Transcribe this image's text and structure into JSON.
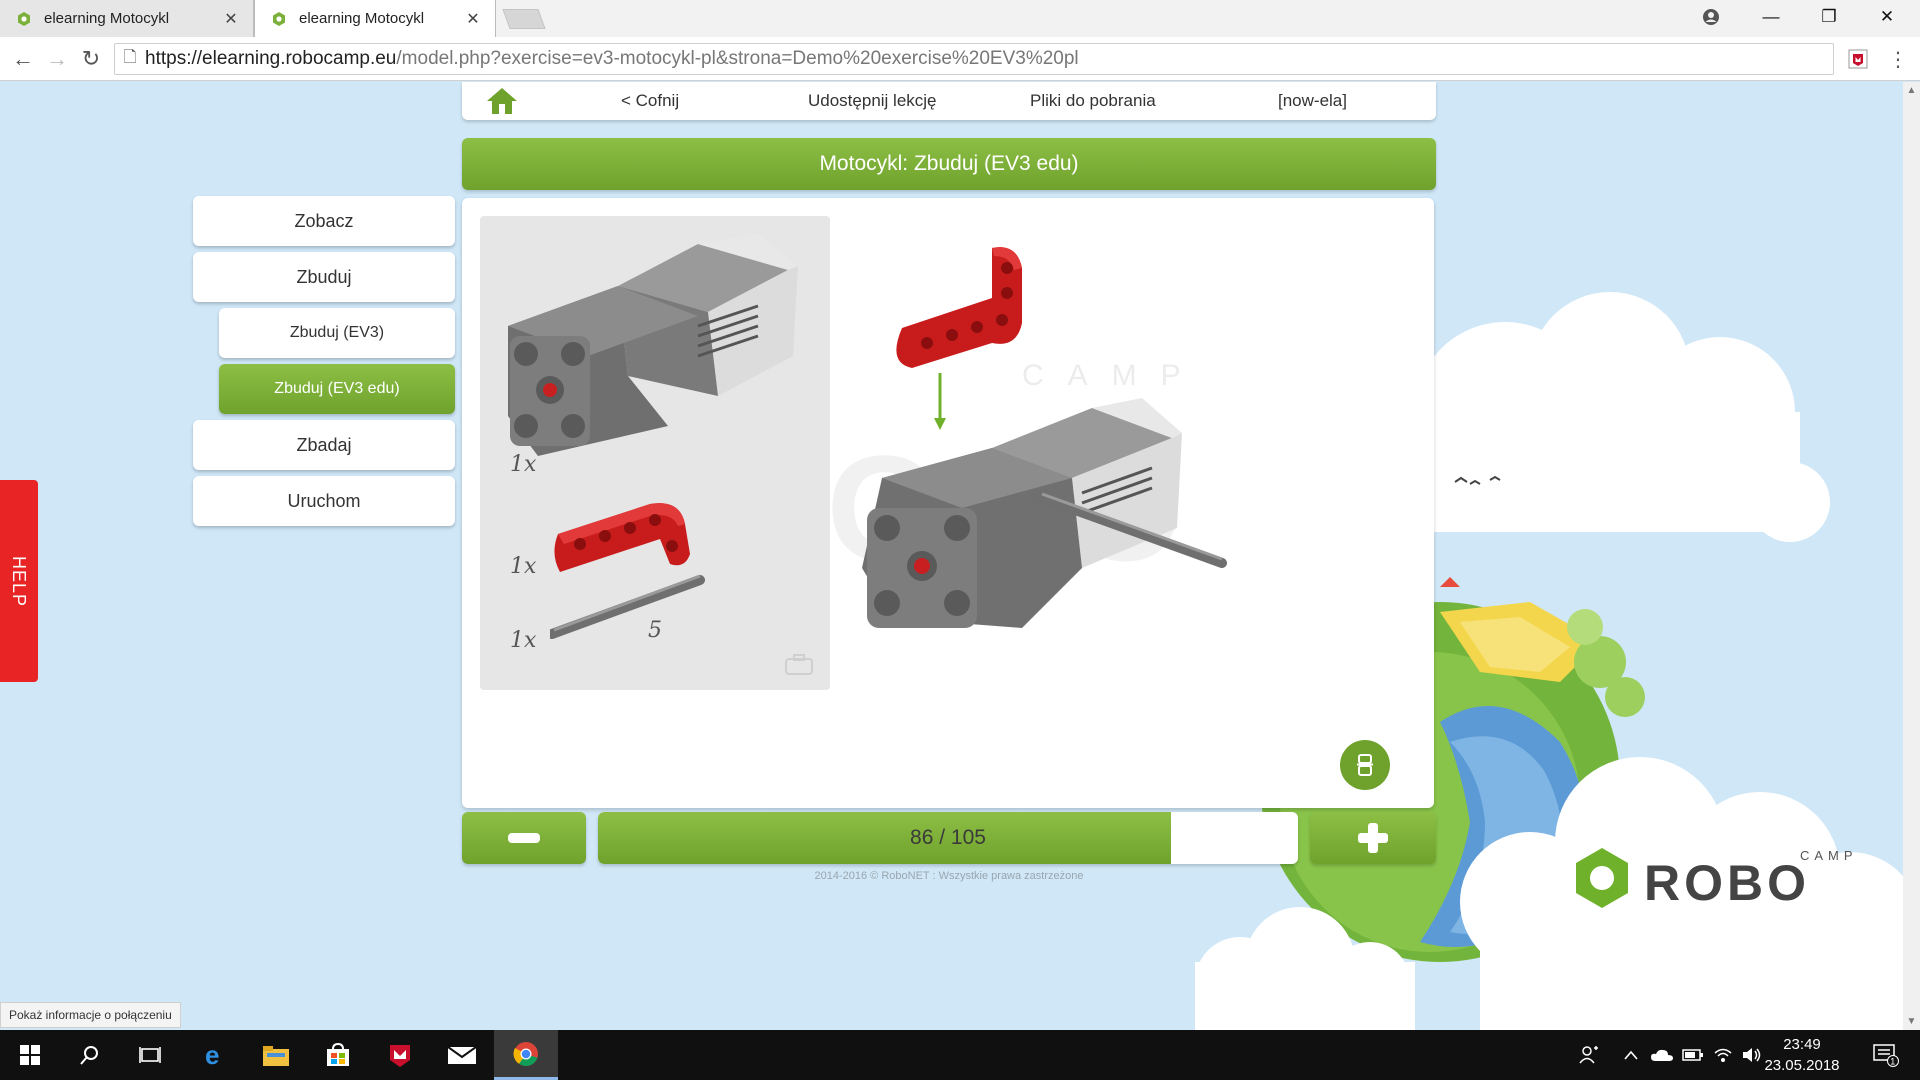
{
  "browser": {
    "tabs": [
      {
        "title": "elearning Motocykl",
        "close": "✕"
      },
      {
        "title": "elearning Motocykl",
        "close": "✕"
      }
    ],
    "window_controls": {
      "minimize": "—",
      "maximize": "❐",
      "close": "✕"
    },
    "nav": {
      "back": "←",
      "forward": "→",
      "reload": "↻"
    },
    "url_host": "https://elearning.robocamp.eu",
    "url_rest": "/model.php?exercise=ev3-motocykl-pl&strona=Demo%20exercise%20EV3%20pl",
    "status_bubble": "Pokaż informacje o połączeniu"
  },
  "topnav": {
    "back_label": "< Cofnij",
    "share_label": "Udostępnij lekcję",
    "downloads_label": "Pliki do pobrania",
    "user_label": "[now-ela]"
  },
  "header": {
    "title": "Motocykl: Zbuduj (EV3 edu)"
  },
  "sidebar": {
    "items": [
      {
        "label": "Zobacz"
      },
      {
        "label": "Zbuduj"
      },
      {
        "label": "Zbuduj (EV3)"
      },
      {
        "label": "Zbuduj (EV3 edu)"
      },
      {
        "label": "Zbadaj"
      },
      {
        "label": "Uruchom"
      }
    ]
  },
  "parts": [
    {
      "qty": "1x",
      "part": "medium-motor"
    },
    {
      "qty": "1x",
      "part": "red-beam-l"
    },
    {
      "qty": "1x",
      "part": "axle",
      "size": "5"
    }
  ],
  "pager": {
    "current": 86,
    "total": 105,
    "label": "86 / 105",
    "progress_percent": 81.9
  },
  "footer": {
    "copyright": "2014-2016 © RoboNET : Wszystkie prawa zastrzeżone"
  },
  "help": {
    "label": "HELP"
  },
  "logo": {
    "word": "ROBO",
    "small": "CAMP"
  },
  "background_watermark": {
    "word": "ROBO",
    "small": "CAMP"
  },
  "taskbar": {
    "time": "23:49",
    "date": "23.05.2018",
    "notifications": "1"
  },
  "colors": {
    "accent_green": "#7bb13a",
    "help_red": "#e82424",
    "sky": "#cfe7f7"
  }
}
